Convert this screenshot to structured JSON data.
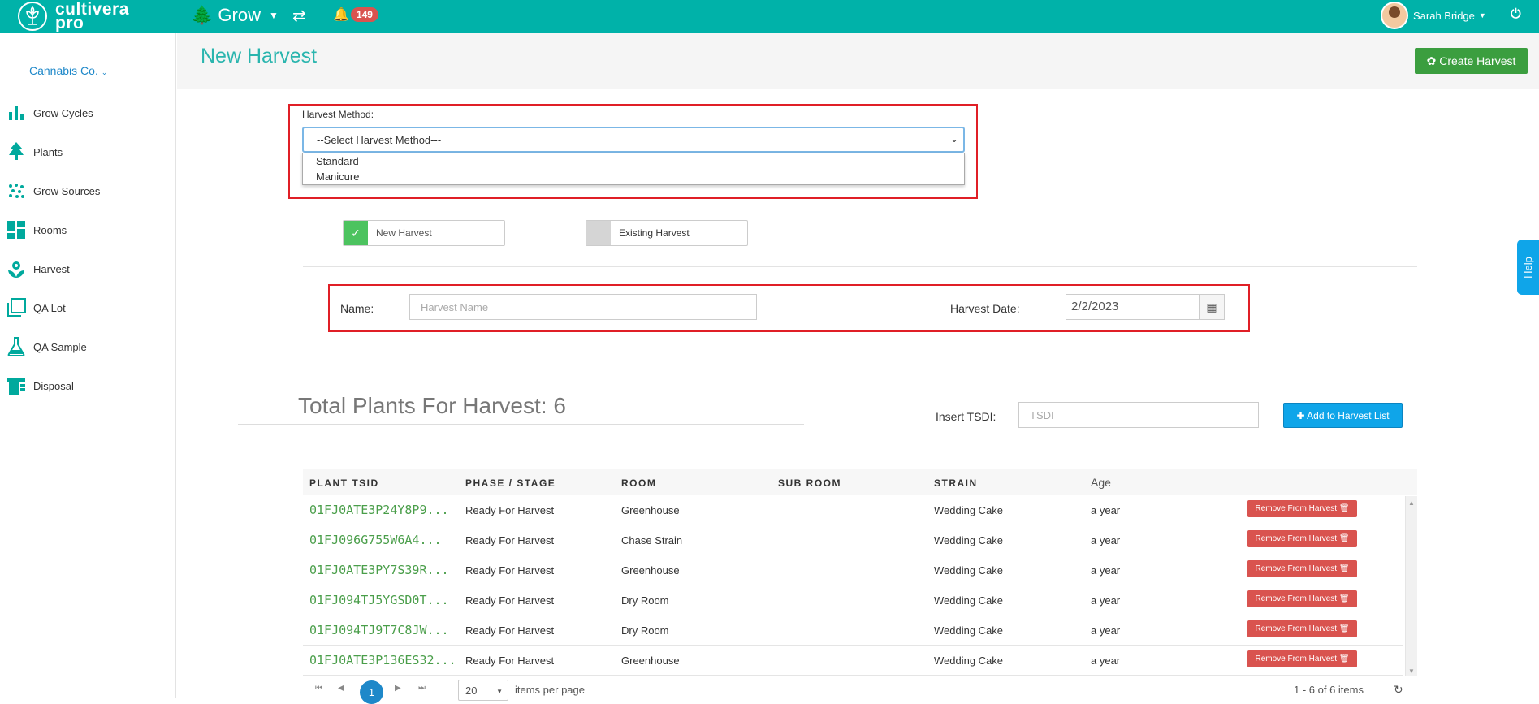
{
  "topbar": {
    "logo_line1": "cultivera",
    "logo_line2": "pro",
    "module": "Grow",
    "notification_count": "149",
    "user_name": "Sarah Bridge"
  },
  "sidebar": {
    "company": "Cannabis Co.",
    "items": [
      {
        "label": "Grow Cycles",
        "icon": "bar-chart-icon"
      },
      {
        "label": "Plants",
        "icon": "tree-icon"
      },
      {
        "label": "Grow Sources",
        "icon": "dots-icon"
      },
      {
        "label": "Rooms",
        "icon": "dashboard-icon"
      },
      {
        "label": "Harvest",
        "icon": "flower-icon"
      },
      {
        "label": "QA Lot",
        "icon": "layers-icon"
      },
      {
        "label": "QA Sample",
        "icon": "flask-icon"
      },
      {
        "label": "Disposal",
        "icon": "trash-icon"
      }
    ]
  },
  "header": {
    "title": "New Harvest",
    "create_button": "Create Harvest"
  },
  "form": {
    "method_label": "Harvest Method:",
    "method_selected": "--Select Harvest Method---",
    "method_options": [
      "Standard",
      "Manicure"
    ],
    "toggle_new": "New Harvest",
    "toggle_existing": "Existing Harvest",
    "name_label": "Name:",
    "name_placeholder": "Harvest Name",
    "date_label": "Harvest Date:",
    "date_value": "2/2/2023"
  },
  "plants": {
    "total_label": "Total Plants For Harvest:",
    "total_count": "6",
    "tsdi_label": "Insert TSDI:",
    "tsdi_placeholder": "TSDI",
    "add_button": "Add to Harvest List",
    "columns": [
      "PLANT TSID",
      "PHASE / STAGE",
      "ROOM",
      "SUB ROOM",
      "STRAIN",
      "Age"
    ],
    "remove_label": "Remove From Harvest",
    "rows": [
      {
        "tsid": "01FJ0ATE3P24Y8P9...",
        "phase": "Ready For Harvest",
        "room": "Greenhouse",
        "sub_room": "",
        "strain": "Wedding Cake",
        "age": "a year"
      },
      {
        "tsid": "01FJ096G755W6A4...",
        "phase": "Ready For Harvest",
        "room": "Chase Strain",
        "sub_room": "",
        "strain": "Wedding Cake",
        "age": "a year"
      },
      {
        "tsid": "01FJ0ATE3PY7S39R...",
        "phase": "Ready For Harvest",
        "room": "Greenhouse",
        "sub_room": "",
        "strain": "Wedding Cake",
        "age": "a year"
      },
      {
        "tsid": "01FJ094TJ5YGSD0T...",
        "phase": "Ready For Harvest",
        "room": "Dry Room",
        "sub_room": "",
        "strain": "Wedding Cake",
        "age": "a year"
      },
      {
        "tsid": "01FJ094TJ9T7C8JW...",
        "phase": "Ready For Harvest",
        "room": "Dry Room",
        "sub_room": "",
        "strain": "Wedding Cake",
        "age": "a year"
      },
      {
        "tsid": "01FJ0ATE3P136ES32...",
        "phase": "Ready For Harvest",
        "room": "Greenhouse",
        "sub_room": "",
        "strain": "Wedding Cake",
        "age": "a year"
      }
    ]
  },
  "pager": {
    "current_page": "1",
    "page_size": "20",
    "per_page_label": "items per page",
    "summary": "1 - 6 of 6 items"
  },
  "help_label": "Help",
  "colors": {
    "brand": "#00b2a9",
    "create": "#3b9e3f",
    "add": "#0fa5e9",
    "remove": "#d9534f",
    "highlight": "#e01f26"
  }
}
